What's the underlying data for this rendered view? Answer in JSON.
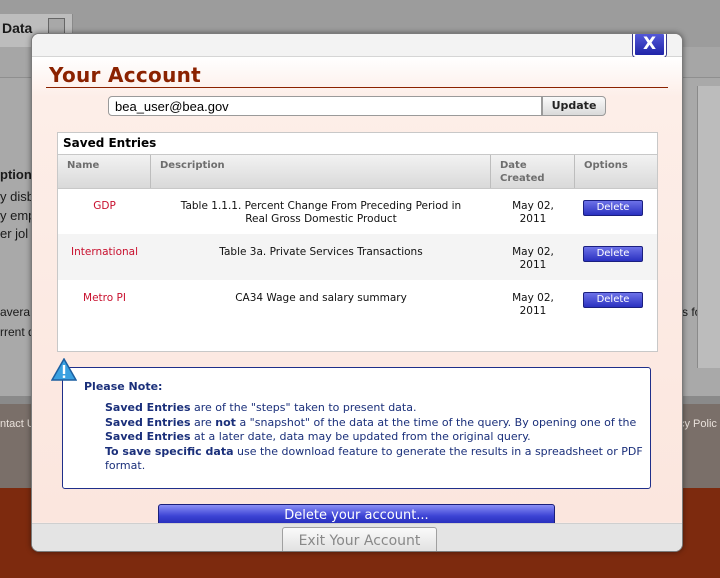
{
  "background": {
    "tab_label": "Data",
    "sidebar_lines": [
      "ption",
      "y disb",
      "y emp",
      "er jol"
    ],
    "left_text_1": "avera",
    "left_text_2": "rrent d",
    "right_text": "s for e",
    "footer_left": "ntact U",
    "footer_right": "cy Polic"
  },
  "modal": {
    "title": "Your Account",
    "close_label": "X",
    "email_value": "bea_user@bea.gov",
    "update_label": "Update",
    "entries_title": "Saved Entries",
    "columns": {
      "name": "Name",
      "description": "Description",
      "date_line1": "Date",
      "date_line2": "Created",
      "options": "Options"
    },
    "rows": [
      {
        "name": "GDP",
        "desc1": "Table 1.1.1. Percent Change From Preceding Period in",
        "desc2": "Real Gross Domestic Product",
        "date1": "May 02,",
        "date2": "2011",
        "action": "Delete"
      },
      {
        "name": "International",
        "desc1": "Table 3a. Private Services Transactions",
        "desc2": "",
        "date1": "May 02,",
        "date2": "2011",
        "action": "Delete"
      },
      {
        "name": "Metro PI",
        "desc1": "CA34 Wage and salary summary",
        "desc2": "",
        "date1": "May 02,",
        "date2": "2011",
        "action": "Delete"
      }
    ],
    "note": {
      "title": "Please Note:",
      "p1_bold": "Saved Entries",
      "p1_rest": " are of the \"steps\" taken to present data.",
      "p2_bold": "Saved Entries",
      "p2_mid": " are ",
      "p2_not": "not",
      "p2_rest": " a \"snapshot\" of the data at the time of the query. By opening one of the ",
      "p2_bold2": "Saved Entries",
      "p2_end": " at a later date, data may be updated from the original query.",
      "p3_bold": "To save specific data",
      "p3_rest": " use the download feature to generate the results in a spreadsheet or PDF format."
    },
    "delete_account_label": "Delete your account...",
    "exit_label": "Exit Your Account"
  },
  "colors": {
    "title": "#8b2200",
    "name_link": "#c8102e",
    "note_text": "#1a2f7a",
    "button_blue": "#2a31c0",
    "footer_band": "#7d2a0e"
  }
}
